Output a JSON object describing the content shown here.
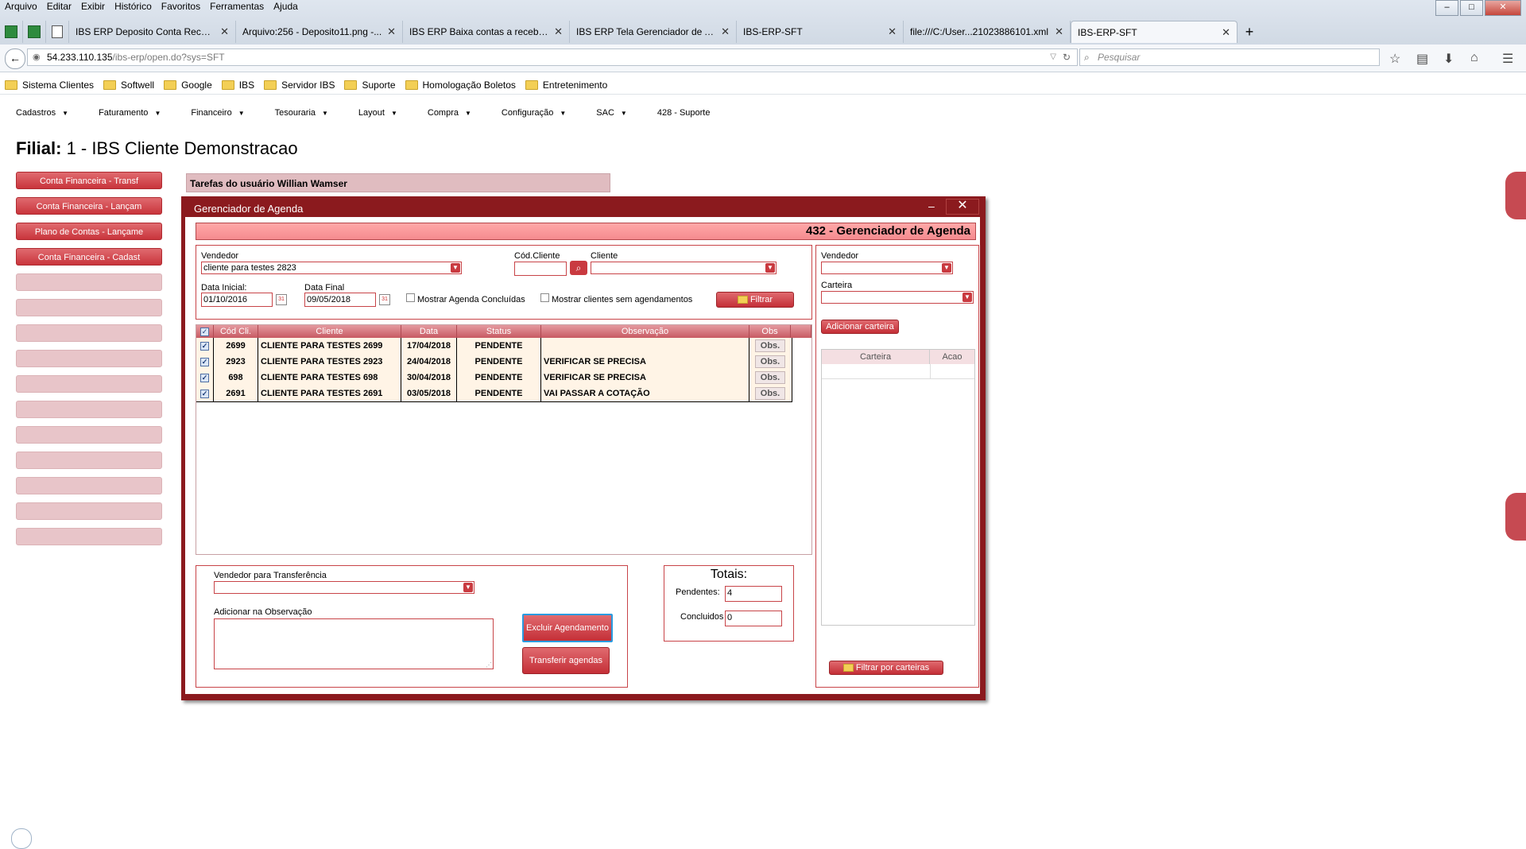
{
  "browser": {
    "menu": [
      "Arquivo",
      "Editar",
      "Exibir",
      "Histórico",
      "Favoritos",
      "Ferramentas",
      "Ajuda"
    ],
    "tabs": [
      {
        "title": "IBS ERP Deposito Conta Recebe..."
      },
      {
        "title": "Arquivo:256 - Deposito11.png -..."
      },
      {
        "title": "IBS ERP Baixa contas a receber ..."
      },
      {
        "title": "IBS ERP Tela Gerenciador de Ag..."
      },
      {
        "title": "IBS-ERP-SFT"
      },
      {
        "title": "file:///C:/User...21023886101.xml"
      },
      {
        "title": "IBS-ERP-SFT"
      }
    ],
    "new_tab": "+",
    "url_host": "54.233.110.135",
    "url_path": "/ibs-erp/open.do?sys=SFT",
    "search_placeholder": "Pesquisar",
    "bookmarks": [
      "Sistema Clientes",
      "Softwell",
      "Google",
      "IBS",
      "Servidor IBS",
      "Suporte",
      "Homologação Boletos",
      "Entretenimento"
    ]
  },
  "app_menu": [
    "Cadastros",
    "Faturamento",
    "Financeiro",
    "Tesouraria",
    "Layout",
    "Compra",
    "Configuração",
    "SAC",
    "428 - Suporte"
  ],
  "filial": {
    "label": "Filial:",
    "value": "1 - IBS Cliente Demonstracao"
  },
  "side_buttons": [
    "Conta Financeira - Transf",
    "Conta Financeira - Lançam",
    "Plano de Contas - Lançame",
    "Conta Financeira - Cadast"
  ],
  "task_panel_title": "Tarefas do usuário Willian Wamser",
  "modal": {
    "title": "Gerenciador de Agenda",
    "minimize": "–",
    "close": "✕",
    "header": "432 - Gerenciador de Agenda",
    "filters": {
      "vendedor_label": "Vendedor",
      "vendedor_value": "cliente para testes 2823",
      "cod_cliente_label": "Cód.Cliente",
      "cod_cliente_value": "",
      "cliente_label": "Cliente",
      "cliente_value": "",
      "data_inicial_label": "Data Inicial:",
      "data_inicial_value": "01/10/2016",
      "data_final_label": "Data Final",
      "data_final_value": "09/05/2018",
      "mostrar_concluidas": "Mostrar Agenda Concluídas",
      "mostrar_sem_agend": "Mostrar clientes sem agendamentos",
      "filtrar": "Filtrar"
    },
    "table": {
      "headers": [
        "Cód Cli.",
        "Cliente",
        "Data",
        "Status",
        "Observação",
        "Obs"
      ],
      "rows": [
        {
          "cod": "2699",
          "cliente": "CLIENTE PARA TESTES 2699",
          "data": "17/04/2018",
          "status": "PENDENTE",
          "obs": "",
          "btn": "Obs."
        },
        {
          "cod": "2923",
          "cliente": "CLIENTE PARA TESTES 2923",
          "data": "24/04/2018",
          "status": "PENDENTE",
          "obs": "VERIFICAR SE PRECISA",
          "btn": "Obs."
        },
        {
          "cod": "698",
          "cliente": "CLIENTE PARA TESTES 698",
          "data": "30/04/2018",
          "status": "PENDENTE",
          "obs": "VERIFICAR SE PRECISA",
          "btn": "Obs."
        },
        {
          "cod": "2691",
          "cliente": "CLIENTE PARA TESTES 2691",
          "data": "03/05/2018",
          "status": "PENDENTE",
          "obs": "VAI PASSAR A COTAÇÃO",
          "btn": "Obs."
        }
      ]
    },
    "transfer": {
      "vendedor_label": "Vendedor para Transferência",
      "obs_label": "Adicionar na Observação",
      "excluir": "Excluir Agendamento",
      "transferir": "Transferir agendas"
    },
    "totais": {
      "title": "Totais:",
      "pendentes_label": "Pendentes:",
      "pendentes_value": "4",
      "concluidos_label": "Concluidos",
      "concluidos_value": "0"
    },
    "right": {
      "vendedor_label": "Vendedor",
      "carteira_label": "Carteira",
      "adicionar": "Adicionar carteira",
      "col_carteira": "Carteira",
      "col_acao": "Acao",
      "filtrar_carteiras": "Filtrar por carteiras"
    }
  }
}
